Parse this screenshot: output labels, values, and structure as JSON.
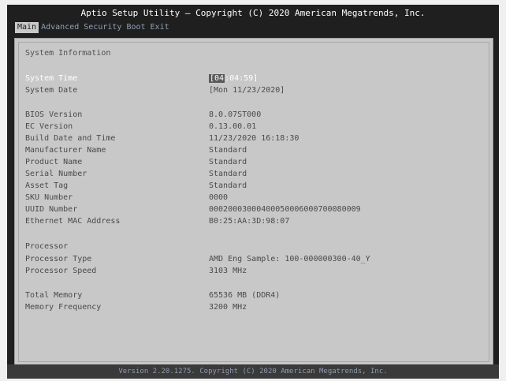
{
  "title": "Aptio Setup Utility – Copyright (C) 2020 American Megatrends, Inc.",
  "menu": [
    "Main",
    "Advanced",
    "Security",
    "Boot",
    "Exit"
  ],
  "section_title": "System Information",
  "system_time": {
    "label": "System Time",
    "hh": "[04",
    "rest": ":04:59]"
  },
  "system_date": {
    "label": "System Date",
    "value": "[Mon 11/23/2020]"
  },
  "info": [
    {
      "label": "BIOS Version",
      "value": "8.0.07ST000"
    },
    {
      "label": "EC Version",
      "value": "0.13.00.01"
    },
    {
      "label": "Build Date and Time",
      "value": "11/23/2020 16:18:30"
    },
    {
      "label": "Manufacturer Name",
      "value": "Standard"
    },
    {
      "label": "Product Name",
      "value": "Standard"
    },
    {
      "label": "Serial Number",
      "value": "Standard"
    },
    {
      "label": "Asset Tag",
      "value": "Standard"
    },
    {
      "label": "SKU Number",
      "value": "0000"
    },
    {
      "label": "UUID Number",
      "value": "00020003000400050006000700080009"
    },
    {
      "label": "Ethernet MAC Address",
      "value": "B0:25:AA:3D:98:07"
    }
  ],
  "processor_header": "Processor",
  "processor": [
    {
      "label": "Processor Type",
      "value": "AMD Eng Sample: 100-000000300-40_Y"
    },
    {
      "label": "Processor Speed",
      "value": "3103 MHz"
    }
  ],
  "memory": [
    {
      "label": "Total Memory",
      "value": "65536 MB (DDR4)"
    },
    {
      "label": "Memory Frequency",
      "value": "3200 MHz"
    }
  ],
  "footer": "Version 2.20.1275. Copyright (C) 2020 American Megatrends, Inc."
}
